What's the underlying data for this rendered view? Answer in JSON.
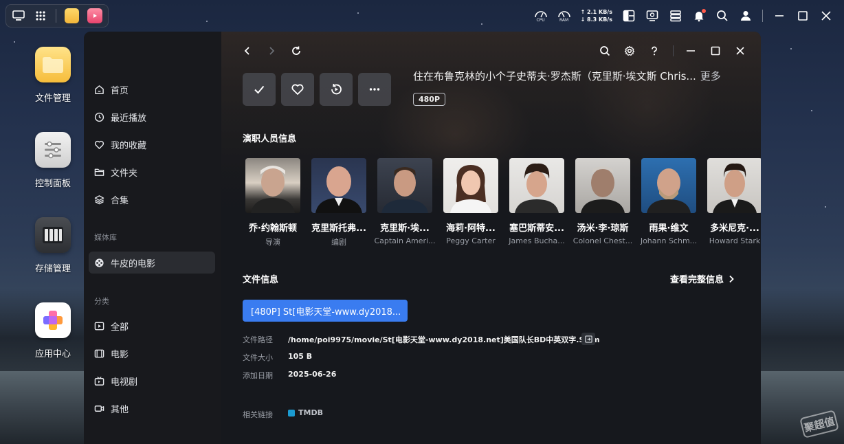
{
  "taskbar": {
    "cpu_label": "CPU",
    "ram_label": "RAM",
    "upload_speed": "↑ 2.1 KB/s",
    "download_speed": "↓ 8.3 KB/s"
  },
  "desktop": {
    "icons": [
      {
        "label": "文件管理"
      },
      {
        "label": "控制面板"
      },
      {
        "label": "存储管理"
      },
      {
        "label": "应用中心"
      }
    ]
  },
  "sidebar": {
    "items": [
      {
        "label": "首页"
      },
      {
        "label": "最近播放"
      },
      {
        "label": "我的收藏"
      },
      {
        "label": "文件夹"
      },
      {
        "label": "合集"
      }
    ],
    "library_section": "媒体库",
    "library_items": [
      {
        "label": "牛皮的电影"
      }
    ],
    "category_section": "分类",
    "category_items": [
      {
        "label": "全部"
      },
      {
        "label": "电影"
      },
      {
        "label": "电视剧"
      },
      {
        "label": "其他"
      }
    ]
  },
  "detail": {
    "overview": "住在布鲁克林的小个子史蒂夫·罗杰斯（克里斯·埃文斯 Chris...",
    "more_label": "更多",
    "resolution_badge": "480P",
    "cast_title": "演职人员信息",
    "cast": [
      {
        "name": "乔·约翰斯顿",
        "role": "导演"
      },
      {
        "name": "克里斯托弗...",
        "role": "编剧"
      },
      {
        "name": "克里斯·埃...",
        "role": "Captain Ameri..."
      },
      {
        "name": "海莉·阿特...",
        "role": "Peggy Carter"
      },
      {
        "name": "塞巴斯蒂安...",
        "role": "James Bucha..."
      },
      {
        "name": "汤米·李·琼斯",
        "role": "Colonel Chest..."
      },
      {
        "name": "雨果·维文",
        "role": "Johann Schm..."
      },
      {
        "name": "多米尼克·...",
        "role": "Howard Stark"
      }
    ],
    "file_title": "文件信息",
    "full_info_label": "查看完整信息",
    "file_button": "[480P] St[电影天堂-www.dy2018...",
    "path_label": "文件路径",
    "path_value": "/home/poi9975/movie/St[电影天堂-www.dy2018.net]美国队长BD中英双字.Strm",
    "size_label": "文件大小",
    "size_value": "105 B",
    "date_label": "添加日期",
    "date_value": "2025-06-26",
    "links_label": "相关链接",
    "tmdb_label": "TMDB"
  },
  "watermark": "聚超值",
  "colors": {
    "accent": "#3a7cf0",
    "window_bg": "#16181d",
    "sidebar_active": "#2a2c31",
    "notification": "#ff5a4a"
  }
}
